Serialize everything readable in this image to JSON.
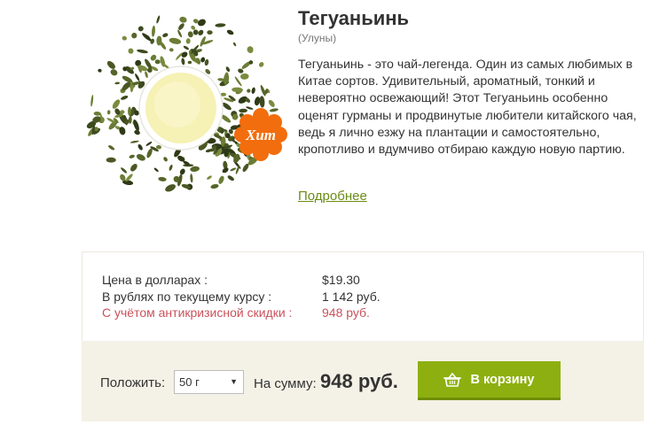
{
  "product": {
    "title": "Тегуаньинь",
    "subtitle": "(Улуны)",
    "description": "Тегуаньинь - это чай-легенда. Один из самых любимых в Китае сортов. Удивительный, ароматный, тонкий и невероятно освежающий! Этот Тегуаньинь особенно оценят гурманы и продвинутые любители китайского чая, ведь я лично езжу на плантации и самостоятельно, кропотливо и вдумчиво отбираю каждую новую партию.",
    "more_link": "Подробнее",
    "badge": "Хит"
  },
  "prices": {
    "usd_label": "Цена в долларах :",
    "usd_value": "$19.30",
    "rub_label": "В рублях по текущему курсу :",
    "rub_value": "1 142 руб.",
    "discount_label": "С учётом антикризисной скидки :",
    "discount_value": "948 руб."
  },
  "order": {
    "qty_label": "Положить:",
    "qty_selected": "50 г",
    "sum_label": "На сумму:",
    "sum_value": "948 руб.",
    "cart_button": "В корзину"
  },
  "colors": {
    "accent_green": "#8db010",
    "badge_orange": "#f26d0d",
    "discount_red": "#c9525c"
  }
}
